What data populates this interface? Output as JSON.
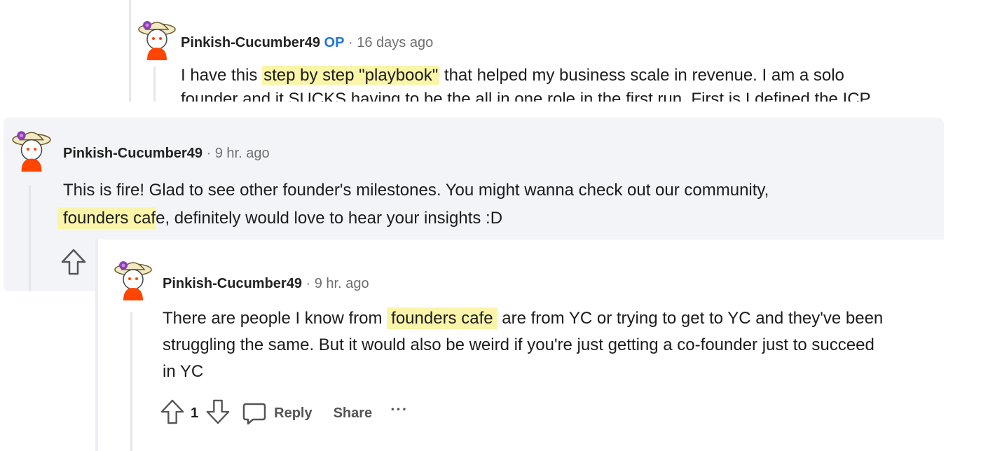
{
  "top_comment": {
    "username": "Pinkish-Cucumber49",
    "op_badge": "OP",
    "separator": "·",
    "time": "16 days ago",
    "body_before": "I have this ",
    "body_highlight": "step by step \"playbook\"",
    "body_after": " that helped my business scale in revenue. I am a solo",
    "body_line2": "founder and it SUCKS having to be the all in one role in the first run. First is I defined the ICP"
  },
  "middle_comment": {
    "username": "Pinkish-Cucumber49",
    "separator": "·",
    "time": "9 hr. ago",
    "body_line1": "This is fire! Glad to see other founder's milestones. You might wanna check out our community,",
    "body_highlight": "founders caf",
    "body_highlight_tail": "e",
    "body_after": ", definitely would love to hear your insights :D"
  },
  "reply_comment": {
    "username": "Pinkish-Cucumber49",
    "separator": "·",
    "time": "9 hr. ago",
    "body_before": "There are people I know from ",
    "body_highlight": "founders cafe",
    "body_after": " are from YC or trying to get to YC and they've been",
    "body_line2": "struggling the same. But it would also be weird if you're just getting a co-founder just to succeed",
    "body_line3": "in YC",
    "actions": {
      "upvote_count": "1",
      "reply_label": "Reply",
      "share_label": "Share",
      "more_label": "···"
    }
  },
  "icons": {
    "upvote": "arrow-up-icon",
    "downvote": "arrow-down-icon",
    "comment": "speech-bubble-icon",
    "more": "ellipsis-icon"
  },
  "colors": {
    "highlight": "#faf5a8",
    "op_badge": "#2476d9",
    "card_bg": "#f2f4f8",
    "avatar_shirt": "#ff4500",
    "avatar_flower": "#8a3fb5"
  }
}
